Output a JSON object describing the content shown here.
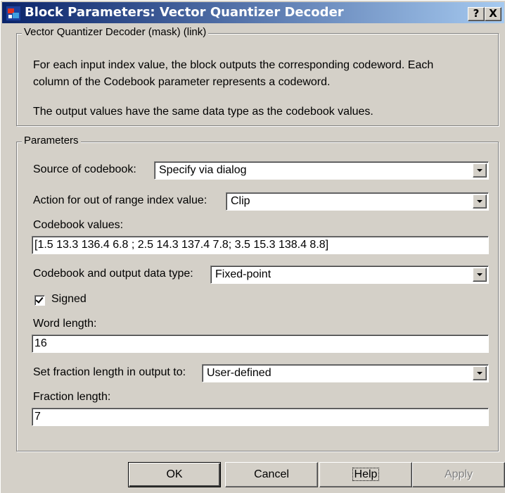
{
  "window": {
    "title": "Block Parameters: Vector Quantizer Decoder",
    "help_button": "?",
    "close_button": "X"
  },
  "description": {
    "legend": "Vector Quantizer Decoder (mask) (link)",
    "line1": "For each input index value, the block outputs the corresponding codeword. Each",
    "line2": "column of the Codebook parameter represents a codeword.",
    "line3": "The output values have the same data type as the codebook values."
  },
  "parameters": {
    "legend": "Parameters",
    "source_label": "Source of codebook:",
    "source_value": "Specify via dialog",
    "action_label": "Action for out of range index value:",
    "action_value": "Clip",
    "codebook_label": "Codebook values:",
    "codebook_value": "[1.5  13.3  136.4  6.8 ; 2.5  14.3  137.4  7.8; 3.5  15.3  138.4  8.8]",
    "datatype_label": "Codebook and output data type:",
    "datatype_value": "Fixed-point",
    "signed_label": "Signed",
    "signed_checked": true,
    "word_length_label": "Word length:",
    "word_length_value": "16",
    "fraction_mode_label": "Set fraction length in output to:",
    "fraction_mode_value": "User-defined",
    "fraction_length_label": "Fraction length:",
    "fraction_length_value": "7"
  },
  "buttons": {
    "ok": "OK",
    "cancel": "Cancel",
    "help": "Help",
    "apply": "Apply"
  }
}
